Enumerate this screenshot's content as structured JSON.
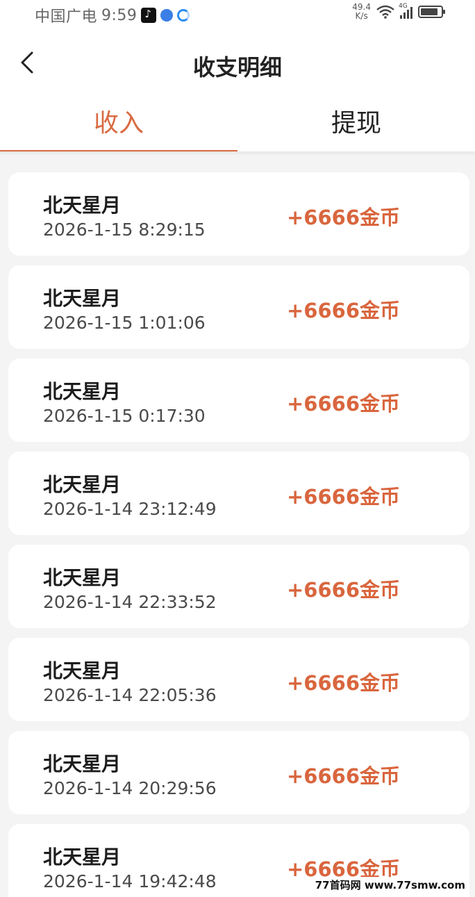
{
  "status_bar": {
    "carrier": "中国广电",
    "time": "9:59",
    "net_speed_value": "49.4",
    "net_speed_unit": "K/s",
    "network_type": "4G",
    "battery_level": 0.85
  },
  "header": {
    "title": "收支明细"
  },
  "tabs": [
    {
      "label": "收入",
      "active": true
    },
    {
      "label": "提现",
      "active": false
    }
  ],
  "records": [
    {
      "name": "北天星月",
      "time": "2026-1-15 8:29:15",
      "amount": "+6666金币"
    },
    {
      "name": "北天星月",
      "time": "2026-1-15 1:01:06",
      "amount": "+6666金币"
    },
    {
      "name": "北天星月",
      "time": "2026-1-15 0:17:30",
      "amount": "+6666金币"
    },
    {
      "name": "北天星月",
      "time": "2026-1-14 23:12:49",
      "amount": "+6666金币"
    },
    {
      "name": "北天星月",
      "time": "2026-1-14 22:33:52",
      "amount": "+6666金币"
    },
    {
      "name": "北天星月",
      "time": "2026-1-14 22:05:36",
      "amount": "+6666金币"
    },
    {
      "name": "北天星月",
      "time": "2026-1-14 20:29:56",
      "amount": "+6666金币"
    },
    {
      "name": "北天星月",
      "time": "2026-1-14 19:42:48",
      "amount": "+6666金币"
    }
  ],
  "watermark": "77首码网 www.77smw.com",
  "colors": {
    "accent": "#d96b43",
    "amount": "#d9663e",
    "background": "#f4f4f4"
  },
  "icons": [
    "back-arrow-icon",
    "tiktok-icon",
    "browser-icon",
    "ring-app-icon",
    "wifi-icon",
    "signal-icon",
    "battery-icon"
  ]
}
